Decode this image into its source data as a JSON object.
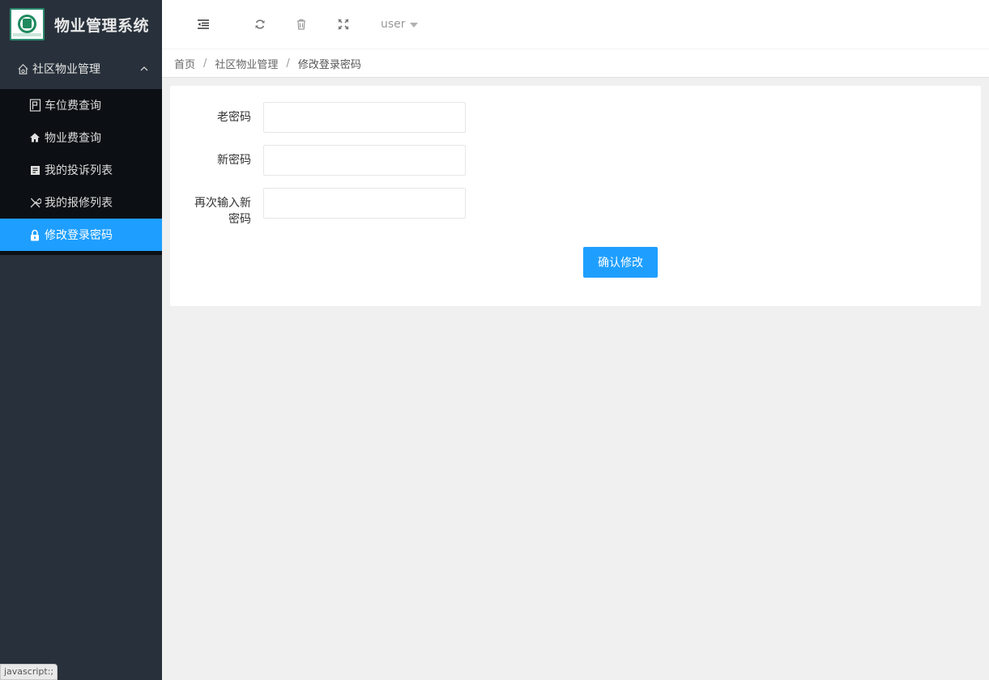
{
  "app": {
    "title": "物业管理系统"
  },
  "sidebar": {
    "group": {
      "label": "社区物业管理",
      "icon": "home-outline-icon",
      "expanded": true
    },
    "items": [
      {
        "label": "车位费查询",
        "icon": "parking-icon"
      },
      {
        "label": "物业费查询",
        "icon": "house-icon"
      },
      {
        "label": "我的投诉列表",
        "icon": "complaint-icon"
      },
      {
        "label": "我的报修列表",
        "icon": "repair-tools-icon"
      },
      {
        "label": "修改登录密码",
        "icon": "lock-icon",
        "active": true
      }
    ]
  },
  "header": {
    "icons": [
      "menu-toggle-icon",
      "refresh-icon",
      "trash-icon",
      "fullscreen-icon"
    ],
    "user": "user"
  },
  "breadcrumb": [
    "首页",
    "社区物业管理",
    "修改登录密码"
  ],
  "form": {
    "old_password_label": "老密码",
    "new_password_label": "新密码",
    "confirm_password_label_line1": "再次输入新",
    "confirm_password_label_line2": "密码",
    "old_password_value": "",
    "new_password_value": "",
    "confirm_password_value": "",
    "submit_label": "确认修改"
  },
  "status_tip": "javascript:;",
  "colors": {
    "sidebar_bg": "#28313b",
    "submenu_bg": "#0c1014",
    "accent": "#1e9fff",
    "content_bg": "#f0f0f0"
  }
}
